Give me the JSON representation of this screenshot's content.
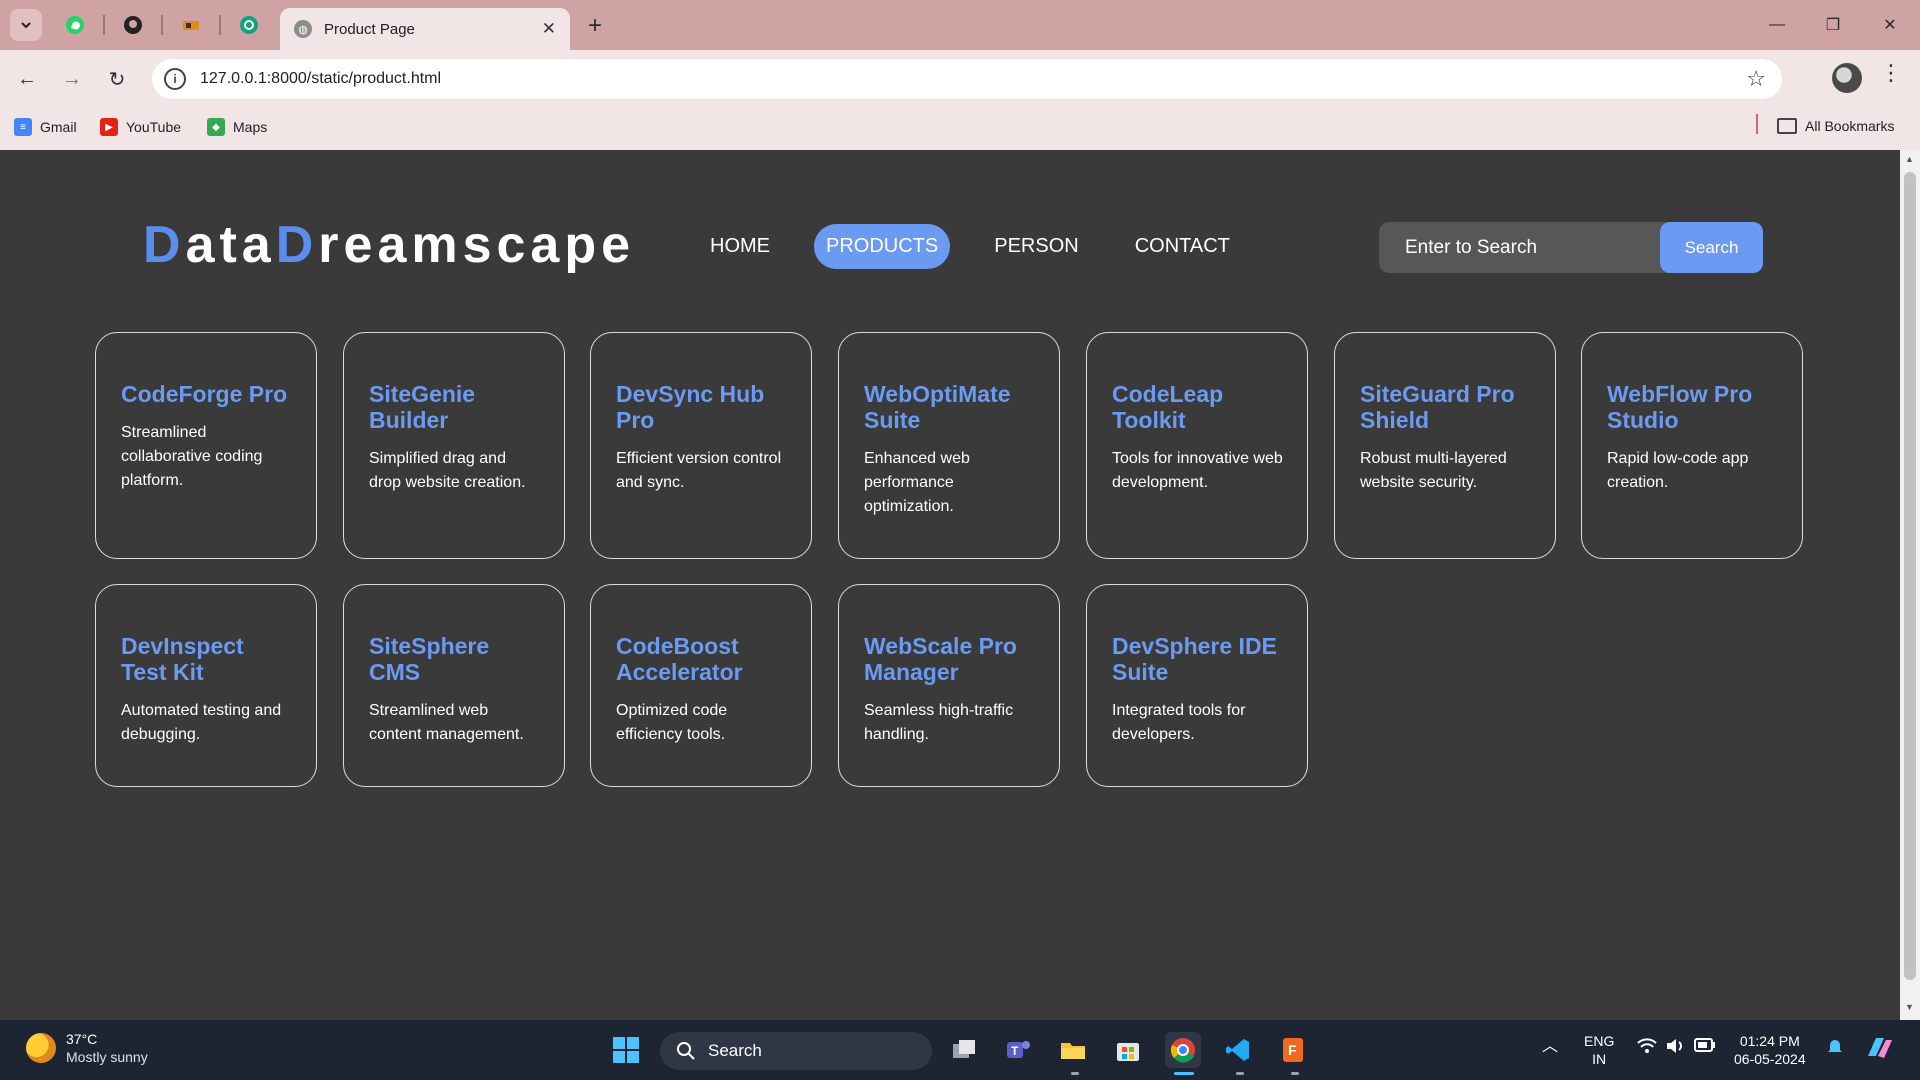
{
  "browser": {
    "tab_title": "Product Page",
    "url": "127.0.0.1:8000/static/product.html",
    "bookmarks": [
      {
        "label": "Gmail",
        "icon": "gmail-icon"
      },
      {
        "label": "YouTube",
        "icon": "youtube-icon"
      },
      {
        "label": "Maps",
        "icon": "maps-icon"
      }
    ],
    "all_bookmarks": "All Bookmarks"
  },
  "site": {
    "logo_parts": [
      "D",
      "ata",
      "D",
      "reamscape"
    ],
    "nav": [
      "HOME",
      "PRODUCTS",
      "PERSON",
      "CONTACT"
    ],
    "active_nav": "PRODUCTS",
    "search_placeholder": "Enter to Search",
    "search_button": "Search",
    "accent_color": "#6a9af1"
  },
  "products": [
    {
      "name": "CodeForge Pro",
      "desc": "Streamlined collaborative coding platform."
    },
    {
      "name": "SiteGenie Builder",
      "desc": "Simplified drag and drop website creation."
    },
    {
      "name": "DevSync Hub Pro",
      "desc": "Efficient version control and sync."
    },
    {
      "name": "WebOptiMate Suite",
      "desc": "Enhanced web performance optimization."
    },
    {
      "name": "CodeLeap Toolkit",
      "desc": "Tools for innovative web development."
    },
    {
      "name": "SiteGuard Pro Shield",
      "desc": "Robust multi-layered website security."
    },
    {
      "name": "WebFlow Pro Studio",
      "desc": "Rapid low-code app creation."
    },
    {
      "name": "DevInspect Test Kit",
      "desc": "Automated testing and debugging."
    },
    {
      "name": "SiteSphere CMS",
      "desc": "Streamlined web content management."
    },
    {
      "name": "CodeBoost Accelerator",
      "desc": "Optimized code efficiency tools."
    },
    {
      "name": "WebScale Pro Manager",
      "desc": "Seamless high-traffic handling."
    },
    {
      "name": "DevSphere IDE Suite",
      "desc": "Integrated tools for developers."
    }
  ],
  "taskbar": {
    "temperature": "37°C",
    "weather": "Mostly sunny",
    "search": "Search",
    "lang_top": "ENG",
    "lang_bottom": "IN",
    "time": "01:24 PM",
    "date": "06-05-2024"
  }
}
